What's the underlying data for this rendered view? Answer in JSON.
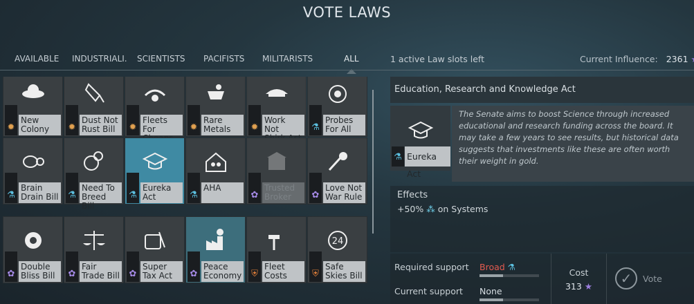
{
  "title": "VOTE LAWS",
  "tabs": [
    "AVAILABLE",
    "INDUSTRIALI.",
    "SCIENTISTS",
    "PACIFISTS",
    "MILITARISTS",
    "ALL"
  ],
  "active_tab": "ALL",
  "slots_text": "1 active Law slots left",
  "influence": {
    "label": "Current Influence:",
    "value": "2361"
  },
  "laws": [
    {
      "label": "New Colony",
      "faction": "industry"
    },
    {
      "label": "Dust Not Rust Bill",
      "faction": "industry"
    },
    {
      "label": "Fleets For Cheaps",
      "faction": "industry"
    },
    {
      "label": "Rare Metals",
      "faction": "industry"
    },
    {
      "label": "Work Not Shirk Act",
      "faction": "industry"
    },
    {
      "label": "Probes For All",
      "faction": "science"
    },
    {
      "label": "Brain Drain Bill",
      "faction": "science"
    },
    {
      "label": "Need To Breed Bill",
      "faction": "science"
    },
    {
      "label": "Eureka Act",
      "faction": "science"
    },
    {
      "label": "AHA",
      "faction": "science"
    },
    {
      "label": "Trusted Broker",
      "faction": "pacifist"
    },
    {
      "label": "Love Not War Rule",
      "faction": "pacifist"
    },
    {
      "label": "Double Bliss Bill",
      "faction": "pacifist"
    },
    {
      "label": "Fair Trade Bill",
      "faction": "pacifist"
    },
    {
      "label": "Super Tax Act",
      "faction": "pacifist"
    },
    {
      "label": "Peace Economy",
      "faction": "pacifist"
    },
    {
      "label": "Fleet Costs",
      "faction": "militarist"
    },
    {
      "label": "Safe Skies Bill",
      "faction": "militarist"
    }
  ],
  "colors": {
    "industry": "#e0a050",
    "science": "#5cc0e0",
    "pacifist": "#a78be8",
    "militarist": "#e07f3a",
    "selected": "#3f8aa3",
    "broad": "#e25a4f"
  },
  "detail": {
    "title": "Education, Research and Knowledge Act",
    "name": "Eureka Act",
    "description": "The Senate aims to boost Science through increased educational and research funding across the board. It may take a few years to see results, but historical data suggests that investments like these are often worth their weight in gold.",
    "effects_header": "Effects",
    "effect_value": "+50%",
    "effect_target": "on Systems",
    "required_support_label": "Required support",
    "required_support_value": "Broad",
    "current_support_label": "Current support",
    "current_support_value": "None",
    "cost_label": "Cost",
    "cost_value": "313",
    "vote_label": "Vote"
  }
}
